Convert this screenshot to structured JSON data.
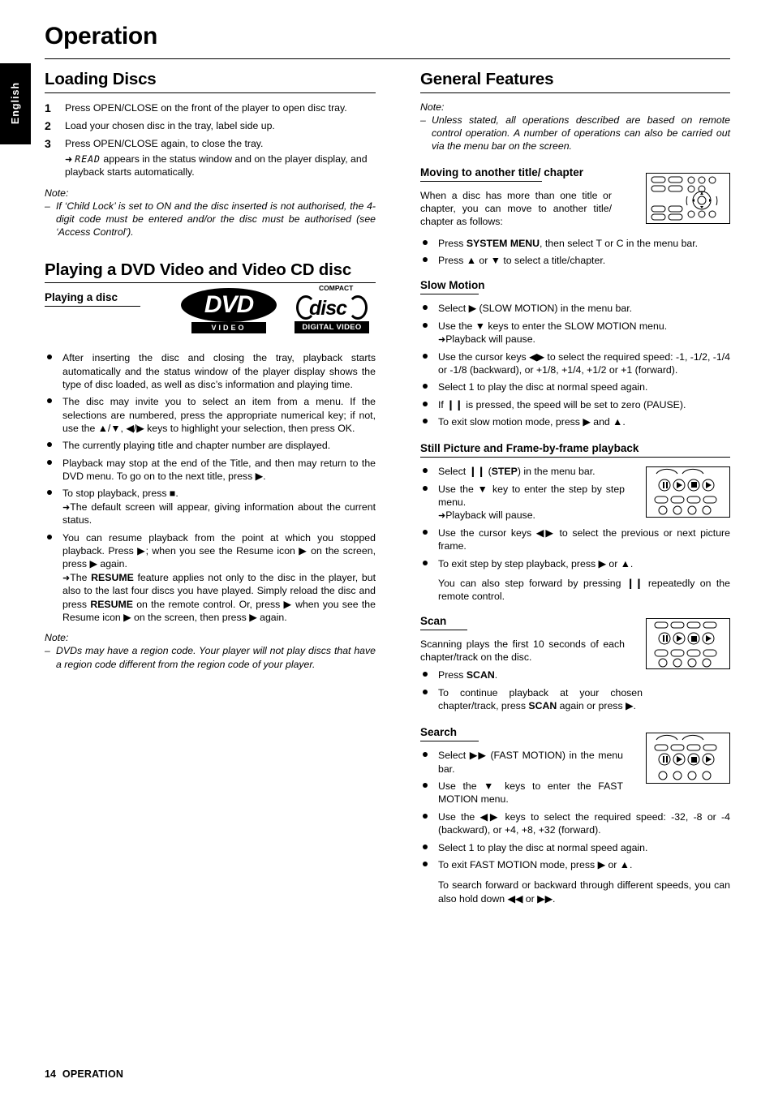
{
  "page": {
    "title": "Operation",
    "language_tab": "English",
    "footer_page_number": "14",
    "footer_section": "OPERATION"
  },
  "left": {
    "loading_discs": {
      "heading": "Loading Discs",
      "steps": [
        {
          "n": "1",
          "text": "Press OPEN/CLOSE on the front of the player to open disc tray."
        },
        {
          "n": "2",
          "text": "Load your chosen disc in the tray, label side up."
        },
        {
          "n": "3",
          "text": "Press OPEN/CLOSE again, to close the tray."
        }
      ],
      "step3_arrow_pre": "appears in the status window and on the player display, and playback starts automatically.",
      "step3_lcd": "READ",
      "note_label": "Note:",
      "note_text": "If ‘Child Lock’ is set to ON and the disc inserted is not authorised, the 4-digit code must be entered and/or the disc must be authorised (see ‘Access Control’)."
    },
    "playing_dvd": {
      "heading": "Playing a DVD Video and Video CD disc",
      "sub_heading": "Playing a disc",
      "logo_dvd_main": "DVD",
      "logo_dvd_sub": "VIDEO",
      "logo_cd_compact": "COMPACT",
      "logo_cd_disc": "disc",
      "logo_cd_digital": "DIGITAL VIDEO",
      "bullets": [
        "After inserting the disc and closing the tray, playback starts automatically and the status window of the player display shows the type of disc loaded, as well as disc’s information and playing time.",
        "The disc may invite you to select an item from a menu. If the selections are numbered, press the appropriate numerical key; if not, use the ▲/▼, ◀/▶ keys to highlight your selection, then press OK.",
        "The currently playing title and chapter number are displayed.",
        "Playback may stop at the end of the Title, and then may return to the DVD menu. To go on to the next title, press ▶.",
        "To stop playback, press ■.",
        "You can resume playback from the point at which you stopped playback. Press ▶; when you see the Resume icon ▶ on the screen, press ▶ again."
      ],
      "arrow_stop": "The default screen will appear, giving information about the current status.",
      "arrow_resume": "The RESUME feature applies not only to the disc in the player, but also to the last four discs you have played. Simply reload the disc and press RESUME on the remote control. Or, press ▶ when you see the Resume icon ▶ on the screen, then press ▶ again.",
      "note_label": "Note:",
      "note_text": "DVDs may have a region code. Your player will not play discs that have a region code different from the region code of your player."
    }
  },
  "right": {
    "general_features": {
      "heading": "General Features",
      "note_label": "Note:",
      "note_text": "Unless stated, all operations described are based on remote control operation. A number of operations can also be carried out via the menu bar on the screen."
    },
    "moving": {
      "heading": "Moving to another title/ chapter",
      "intro": "When a disc has more than one title or chapter, you can move to another title/ chapter as follows:",
      "bullets": [
        "Press SYSTEM MENU, then select T or C in the menu bar.",
        "Press ▲ or ▼ to select a title/chapter."
      ]
    },
    "slow_motion": {
      "heading": "Slow Motion",
      "bullets": [
        "Select ▶ (SLOW MOTION) in the menu bar.",
        "Use the ▼ keys to enter the SLOW MOTION menu.",
        "Use the cursor keys ◀▶ to select the required speed: -1, -1/2, -1/4 or -1/8 (backward), or +1/8, +1/4, +1/2 or +1 (forward).",
        "Select 1 to play the disc at normal speed again.",
        "If ❙❙ is pressed, the speed will be set to zero (PAUSE).",
        "To exit slow motion mode, press ▶ and ▲."
      ],
      "arrow_pause": "Playback will pause."
    },
    "still_picture": {
      "heading": "Still Picture and Frame-by-frame playback",
      "bullets": [
        "Select ❙❙ (STEP) in the menu bar.",
        "Use the ▼ key to enter the step by step menu.",
        "Use the cursor keys ◀▶ to select the previous or next picture frame.",
        "To exit step by step playback, press ▶ or ▲."
      ],
      "arrow_pause": "Playback will pause.",
      "closing": "You can also step forward by pressing ❙❙ repeatedly on the remote control."
    },
    "scan": {
      "heading": "Scan",
      "intro": "Scanning plays the first 10 seconds of each chapter/track on the disc.",
      "bullets": [
        "Press SCAN.",
        "To continue playback at your chosen chapter/track, press SCAN again or press ▶."
      ]
    },
    "search": {
      "heading": "Search",
      "bullets": [
        "Select ▶▶ (FAST MOTION) in the menu bar.",
        "Use the ▼ keys to enter the FAST MOTION menu.",
        "Use the ◀▶ keys to select the required speed: -32, -8 or -4 (backward), or +4, +8, +32 (forward).",
        "Select 1 to play the disc at normal speed again.",
        "To exit FAST MOTION mode, press ▶ or ▲."
      ],
      "closing": "To search forward or backward through different speeds, you can also hold down ◀◀ or ▶▶."
    }
  }
}
